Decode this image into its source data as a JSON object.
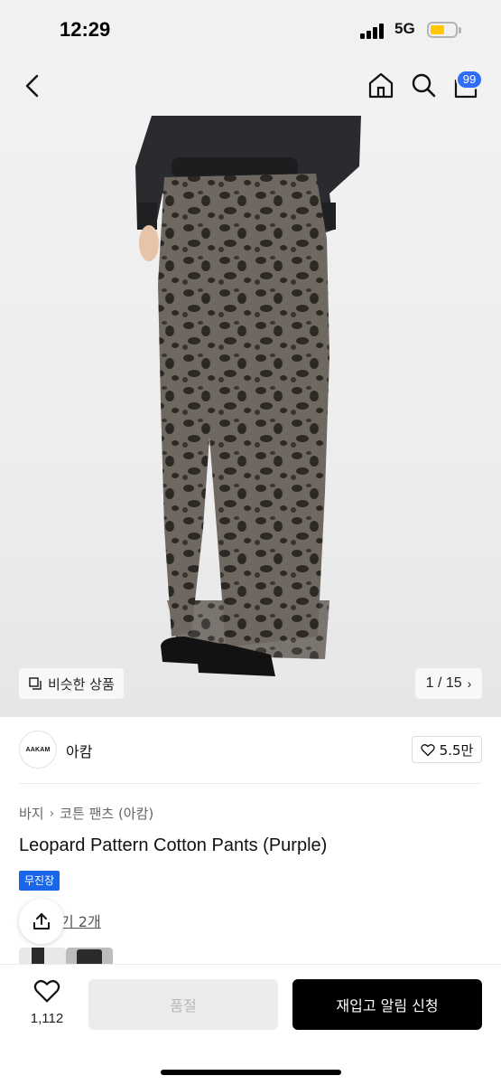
{
  "status": {
    "time": "12:29",
    "network": "5G"
  },
  "nav": {
    "cart_count": "99"
  },
  "gallery": {
    "similar_label": "비슷한 상품",
    "page_indicator": "1 / 15"
  },
  "brand": {
    "logo_text": "AAKAM",
    "name": "아캄",
    "likes": "5.5만"
  },
  "breadcrumb": {
    "category": "바지",
    "subcategory": "코튼 팬츠 (아캄)"
  },
  "product": {
    "title": "Leopard Pattern Cotton Pants (Purple)",
    "badge": "무진장",
    "review_link": "기 2개"
  },
  "bottom": {
    "wishlist_count": "1,112",
    "soldout_label": "품절",
    "restock_label": "재입고 알림 신청"
  },
  "colors": {
    "accent_blue": "#1a66e8",
    "badge_blue": "#2f6df6",
    "battery": "#ffc800"
  }
}
